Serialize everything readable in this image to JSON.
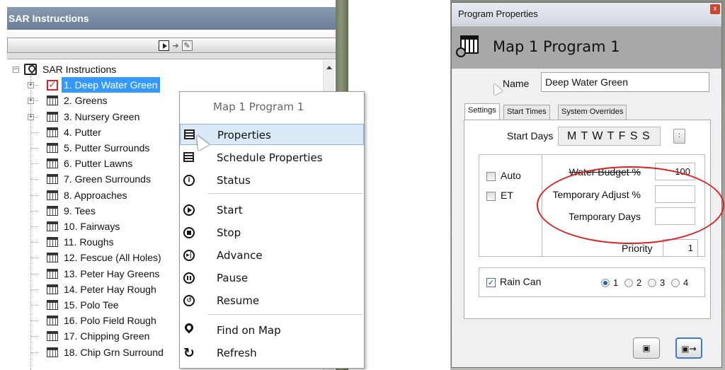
{
  "left": {
    "header_title": "SAR Instructions",
    "tree_root": "SAR Instructions",
    "tree_items": [
      "1. Deep Water Green",
      "2. Greens",
      "3. Nursery Green",
      "4. Putter",
      "5. Putter Surrounds",
      "6. Putter Lawns",
      "7. Green Surrounds",
      "8. Approaches",
      "9. Tees",
      "10. Fairways",
      "11. Roughs",
      "12. Fescue (All Holes)",
      "13. Peter Hay Greens",
      "14. Peter Hay Rough",
      "15. Polo Tee",
      "16. Polo Field Rough",
      "17. Chipping Green",
      "18. Chip Grn Surround"
    ],
    "selected_index": 0
  },
  "context_menu": {
    "title": "Map 1 Program 1",
    "items": {
      "properties": "Properties",
      "schedule_properties": "Schedule Properties",
      "status": "Status",
      "start": "Start",
      "stop": "Stop",
      "advance": "Advance",
      "pause": "Pause",
      "resume": "Resume",
      "find_on_map": "Find on Map",
      "refresh": "Refresh"
    },
    "hovered": "properties"
  },
  "dialog": {
    "window_title": "Program Properties",
    "close_glyph": "x",
    "header_title": "Map 1 Program 1",
    "name_label": "Name",
    "name_value": "Deep Water Green",
    "tabs": [
      "Settings",
      "Start Times",
      "System Overrides"
    ],
    "active_tab": "Settings",
    "start_days_label": "Start Days",
    "start_days_value": "M T W T F S S",
    "start_days_button": ":",
    "auto_label": "Auto",
    "auto_checked": false,
    "et_label": "ET",
    "et_checked": false,
    "water_budget_label": "Water Budget %",
    "water_budget_value": "100",
    "temp_adjust_label": "Temporary Adjust %",
    "temp_adjust_value": "",
    "temp_days_label": "Temporary Days",
    "temp_days_value": "",
    "priority_label": "Priority",
    "priority_value": "1",
    "rain_can_label": "Rain Can",
    "rain_can_checked": true,
    "rain_can_check_glyph": "✓",
    "rain_options": [
      "1",
      "2",
      "3",
      "4"
    ],
    "rain_selected": "1",
    "save_button_glyph": "▣",
    "save_close_button_glyph": "▣→"
  },
  "colors": {
    "selection": "#3399ff",
    "menu_hover": "#dbe9f8",
    "annotation_red": "#e02020",
    "header_gray": "#a8a8a8"
  }
}
